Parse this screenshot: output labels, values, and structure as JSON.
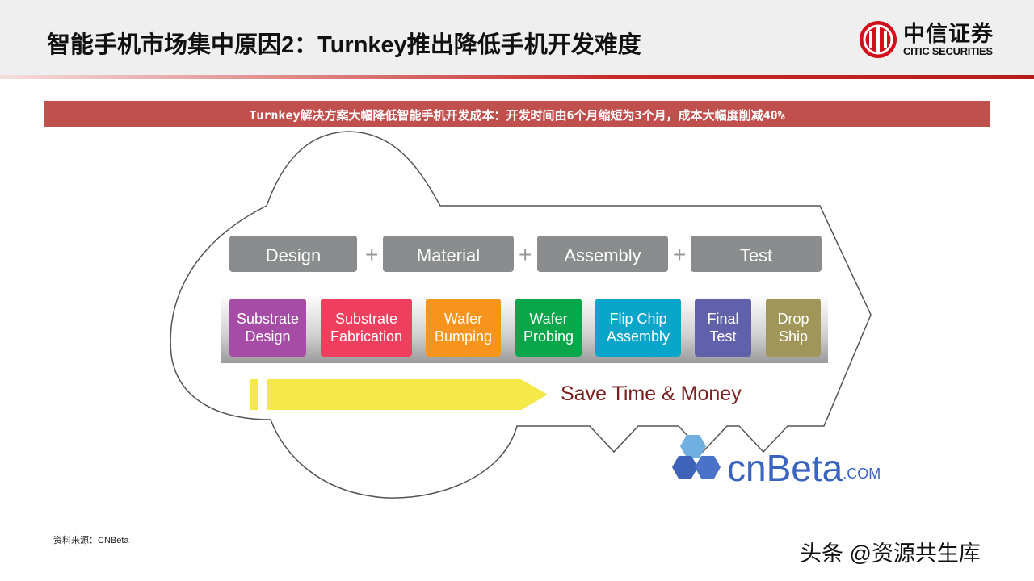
{
  "title": "智能手机市场集中原因2：Turnkey推出降低手机开发难度",
  "logo": {
    "cn": "中信证券",
    "en": "CITIC SECURITIES"
  },
  "banner": "Turnkey解决方案大幅降低智能手机开发成本：开发时间由6个月缩短为3个月，成本大幅度削减40%",
  "phases": [
    "Design",
    "Material",
    "Assembly",
    "Test"
  ],
  "plus": "+",
  "steps": [
    {
      "label": "Substrate Design",
      "color": "#a64ca6"
    },
    {
      "label": "Substrate Fabrication",
      "color": "#ee3f5f"
    },
    {
      "label": "Wafer Bumping",
      "color": "#f7941d"
    },
    {
      "label": "Wafer Probing",
      "color": "#0aa64a"
    },
    {
      "label": "Flip Chip Assembly",
      "color": "#09a6c9"
    },
    {
      "label": "Final Test",
      "color": "#6060ab"
    },
    {
      "label": "Drop Ship",
      "color": "#a0965a"
    }
  ],
  "save": "Save Time & Money",
  "cnbeta": {
    "main": "cnBeta",
    "suffix": ".COM"
  },
  "source": "资料来源：CNBeta",
  "watermark": "头条 @资源共生库"
}
